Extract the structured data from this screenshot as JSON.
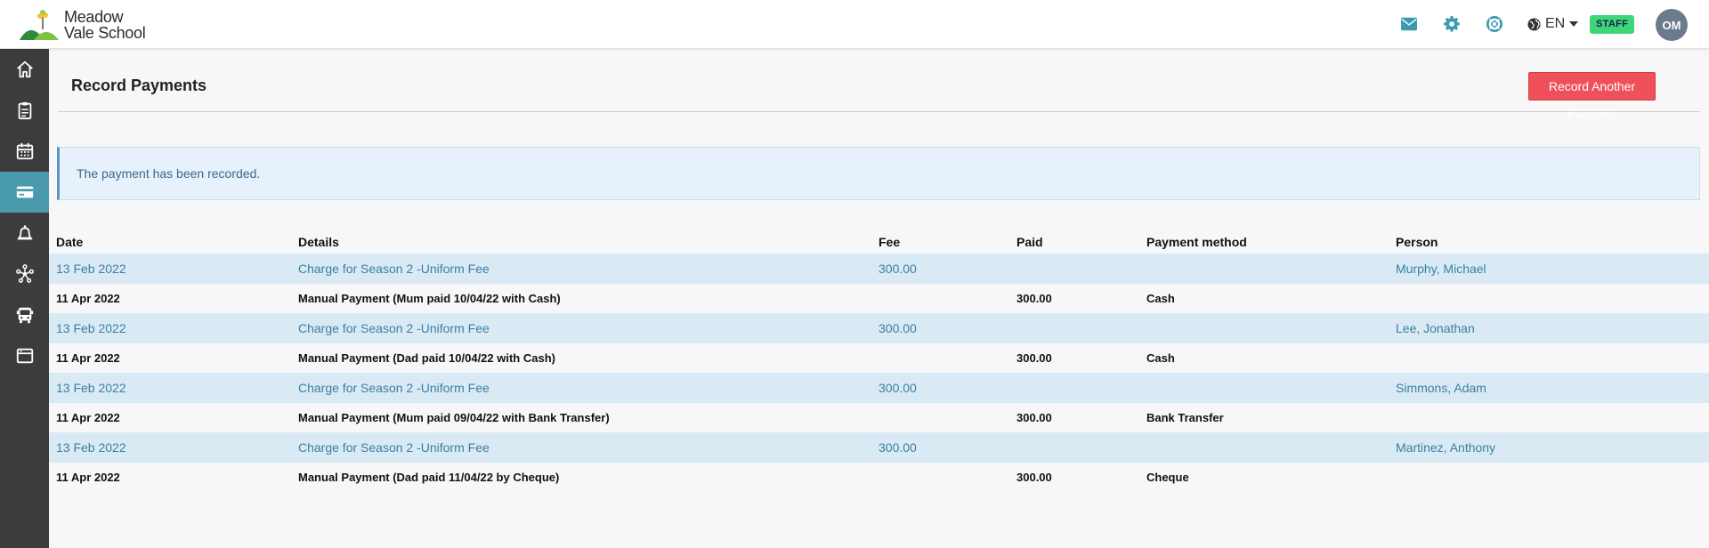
{
  "app": {
    "logo_line1": "Meadow",
    "logo_line2": "Vale School"
  },
  "header": {
    "icons": [
      "mail-icon",
      "gear-icon",
      "lifebuoy-icon"
    ],
    "language": "EN",
    "role_badge": "STAFF",
    "avatar_initials": "OM"
  },
  "colors": {
    "accent": "#4a9aae",
    "button": "#f0505a",
    "badge": "#3fd67a",
    "row_highlight": "#daeaf4"
  },
  "sidebar": {
    "items": [
      {
        "icon": "home-icon",
        "active": false
      },
      {
        "icon": "clipboard-icon",
        "active": false
      },
      {
        "icon": "calendar-icon",
        "active": false
      },
      {
        "icon": "credit-card-icon",
        "active": true
      },
      {
        "icon": "bell-icon",
        "active": false
      },
      {
        "icon": "network-icon",
        "active": false
      },
      {
        "icon": "bus-icon",
        "active": false
      },
      {
        "icon": "browser-window-icon",
        "active": false
      }
    ]
  },
  "page": {
    "title": "Record Payments",
    "record_button": "Record Another Payment",
    "alert": "The payment has been recorded."
  },
  "table": {
    "headers": {
      "date": "Date",
      "details": "Details",
      "fee": "Fee",
      "paid": "Paid",
      "method": "Payment method",
      "person": "Person"
    },
    "rows": [
      {
        "date": "13 Feb 2022",
        "details": "Charge for Season 2 -Uniform Fee",
        "fee": "300.00",
        "paid": "",
        "method": "",
        "person": "Murphy, Michael"
      },
      {
        "date": "11 Apr 2022",
        "details": "Manual Payment (Mum paid 10/04/22 with Cash)",
        "fee": "",
        "paid": "300.00",
        "method": "Cash",
        "person": ""
      },
      {
        "date": "13 Feb 2022",
        "details": "Charge for Season 2 -Uniform Fee",
        "fee": "300.00",
        "paid": "",
        "method": "",
        "person": "Lee, Jonathan"
      },
      {
        "date": "11 Apr 2022",
        "details": "Manual Payment (Dad paid 10/04/22 with Cash)",
        "fee": "",
        "paid": "300.00",
        "method": "Cash",
        "person": ""
      },
      {
        "date": "13 Feb 2022",
        "details": "Charge for Season 2 -Uniform Fee",
        "fee": "300.00",
        "paid": "",
        "method": "",
        "person": "Simmons, Adam"
      },
      {
        "date": "11 Apr 2022",
        "details": "Manual Payment (Mum paid 09/04/22 with Bank Transfer)",
        "fee": "",
        "paid": "300.00",
        "method": "Bank Transfer",
        "person": ""
      },
      {
        "date": "13 Feb 2022",
        "details": "Charge for Season 2 -Uniform Fee",
        "fee": "300.00",
        "paid": "",
        "method": "",
        "person": "Martinez, Anthony"
      },
      {
        "date": "11 Apr 2022",
        "details": "Manual Payment (Dad paid 11/04/22 by Cheque)",
        "fee": "",
        "paid": "300.00",
        "method": "Cheque",
        "person": ""
      }
    ]
  }
}
